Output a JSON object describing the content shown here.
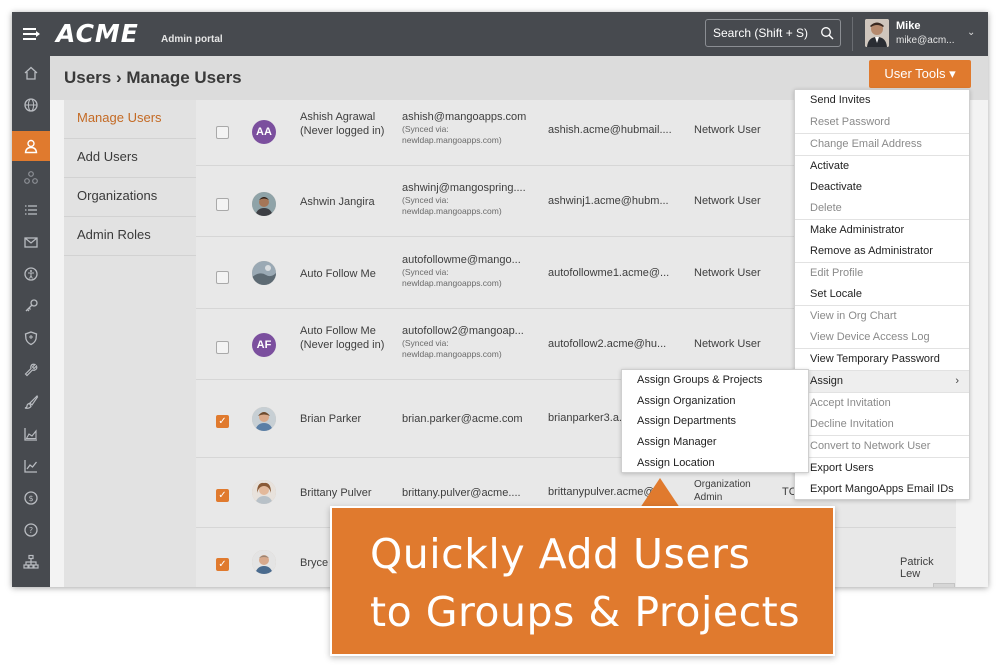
{
  "topbar": {
    "logo": "ACME",
    "subtitle": "Admin portal",
    "search_placeholder": "Search (Shift + S)",
    "user_name": "Mike",
    "user_email": "mike@acm..."
  },
  "header": {
    "breadcrumb": "Users › Manage Users",
    "user_tools_label": "User Tools ▾"
  },
  "left_menu": [
    {
      "label": "Manage Users"
    },
    {
      "label": "Add Users"
    },
    {
      "label": "Organizations"
    },
    {
      "label": "Admin Roles"
    }
  ],
  "rows": [
    {
      "initials": "AA",
      "name": "Ashish Agrawal (Never logged in)",
      "email": "ashish@mangoapps.com",
      "synced": [
        "(Synced via:",
        "newldap.mangoapps.com)"
      ],
      "username": "ashish.acme@hubmail....",
      "type": "Network User",
      "checked": false
    },
    {
      "name": "Ashwin Jangira",
      "email": "ashwinj@mangospring....",
      "synced": [
        "(Synced via:",
        "newldap.mangoapps.com)"
      ],
      "username": "ashwinj1.acme@hubm...",
      "type": "Network User",
      "checked": false
    },
    {
      "name": "Auto Follow Me",
      "email": "autofollowme@mango...",
      "synced": [
        "(Synced via:",
        "newldap.mangoapps.com)"
      ],
      "username": "autofollowme1.acme@...",
      "type": "Network User",
      "checked": false
    },
    {
      "initials": "AF",
      "name": "Auto Follow Me (Never logged in)",
      "email": "autofollow2@mangoap...",
      "synced": [
        "(Synced via:",
        "newldap.mangoapps.com)"
      ],
      "username": "autofollow2.acme@hu...",
      "type": "Network User",
      "checked": false
    },
    {
      "name": "Brian Parker",
      "email": "brian.parker@acme.com",
      "username": "brianparker3.a...",
      "type": "",
      "checked": true
    },
    {
      "name": "Brittany Pulver",
      "email": "brittany.pulver@acme....",
      "username": "brittanypulver.acme@h...",
      "type": "Organization Admin",
      "type_extra": "TC",
      "checked": true
    },
    {
      "name": "Bryce",
      "email": "",
      "username": "",
      "type": "",
      "checked": true
    }
  ],
  "patrick_text": "Patrick Lew",
  "scroll_up_glyph": "^",
  "tools_menu": [
    {
      "label": "Send Invites",
      "disabled": false
    },
    {
      "label": "Reset Password",
      "disabled": true
    },
    {
      "label": "Change Email Address",
      "disabled": true
    },
    {
      "label": "Activate",
      "disabled": false
    },
    {
      "label": "Deactivate",
      "disabled": false
    },
    {
      "label": "Delete",
      "disabled": true
    },
    {
      "label": "Make Administrator",
      "disabled": false
    },
    {
      "label": "Remove as Administrator",
      "disabled": false
    },
    {
      "label": "Edit Profile",
      "disabled": true
    },
    {
      "label": "Set Locale",
      "disabled": false
    },
    {
      "label": "View in Org Chart",
      "disabled": true
    },
    {
      "label": "View Device Access Log",
      "disabled": true
    },
    {
      "label": "View Temporary Password",
      "disabled": false
    },
    {
      "label": "Assign",
      "disabled": false,
      "submenu_caret": "›"
    },
    {
      "label": "Accept Invitation",
      "disabled": true
    },
    {
      "label": "Decline Invitation",
      "disabled": true
    },
    {
      "label": "Convert to Network User",
      "disabled": true
    },
    {
      "label": "Export Users",
      "disabled": false
    },
    {
      "label": "Export MangoApps Email IDs",
      "disabled": false
    }
  ],
  "assign_submenu": [
    {
      "label": "Assign Groups & Projects"
    },
    {
      "label": "Assign Organization"
    },
    {
      "label": "Assign Departments"
    },
    {
      "label": "Assign Manager"
    },
    {
      "label": "Assign Location"
    }
  ],
  "callout": {
    "line1": "Quickly Add Users",
    "line2": "to Groups & Projects"
  },
  "rail_icons": [
    "home-icon",
    "globe-icon",
    "user-icon",
    "network-icon",
    "list-icon",
    "mail-icon",
    "accessibility-icon",
    "key-icon",
    "shield-icon",
    "wrench-icon",
    "brush-icon",
    "chart-area-icon",
    "chart-line-icon",
    "dollar-icon",
    "help-icon",
    "sitemap-icon"
  ],
  "colors": {
    "accent": "#e07a2e",
    "topbar": "#474a4f",
    "initials_avatar": "#7b4f9e"
  }
}
